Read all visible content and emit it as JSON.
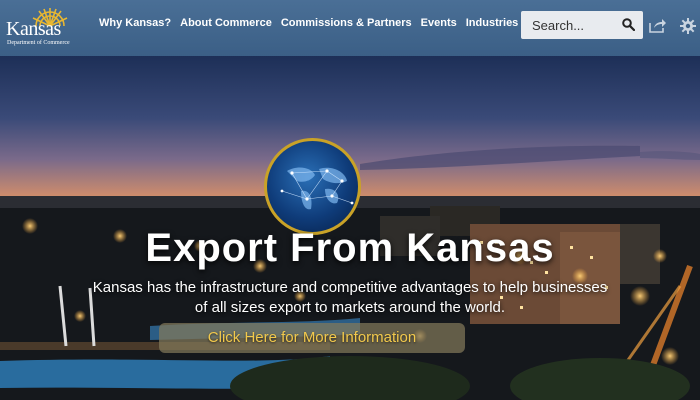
{
  "header": {
    "logo": {
      "wordmark": "Kansas",
      "subtitle": "Department of Commerce"
    },
    "nav": [
      {
        "label": "Why Kansas?"
      },
      {
        "label": "About Commerce"
      },
      {
        "label": "Commissions & Partners"
      },
      {
        "label": "Events"
      },
      {
        "label": "Industries"
      }
    ],
    "search": {
      "placeholder": "Search..."
    },
    "icons": [
      "search-icon",
      "share-icon",
      "gear-icon"
    ]
  },
  "hero": {
    "headline": "Export From Kansas",
    "tagline_line1": "Kansas has the infrastructure and competitive advantages to help businesses",
    "tagline_line2": "of all sizes export to markets around the world.",
    "cta_label": "Click Here for More Information"
  },
  "colors": {
    "header_bg": "#3b5f86",
    "accent_gold": "#f2c94c",
    "globe_ring": "#c9a227"
  }
}
